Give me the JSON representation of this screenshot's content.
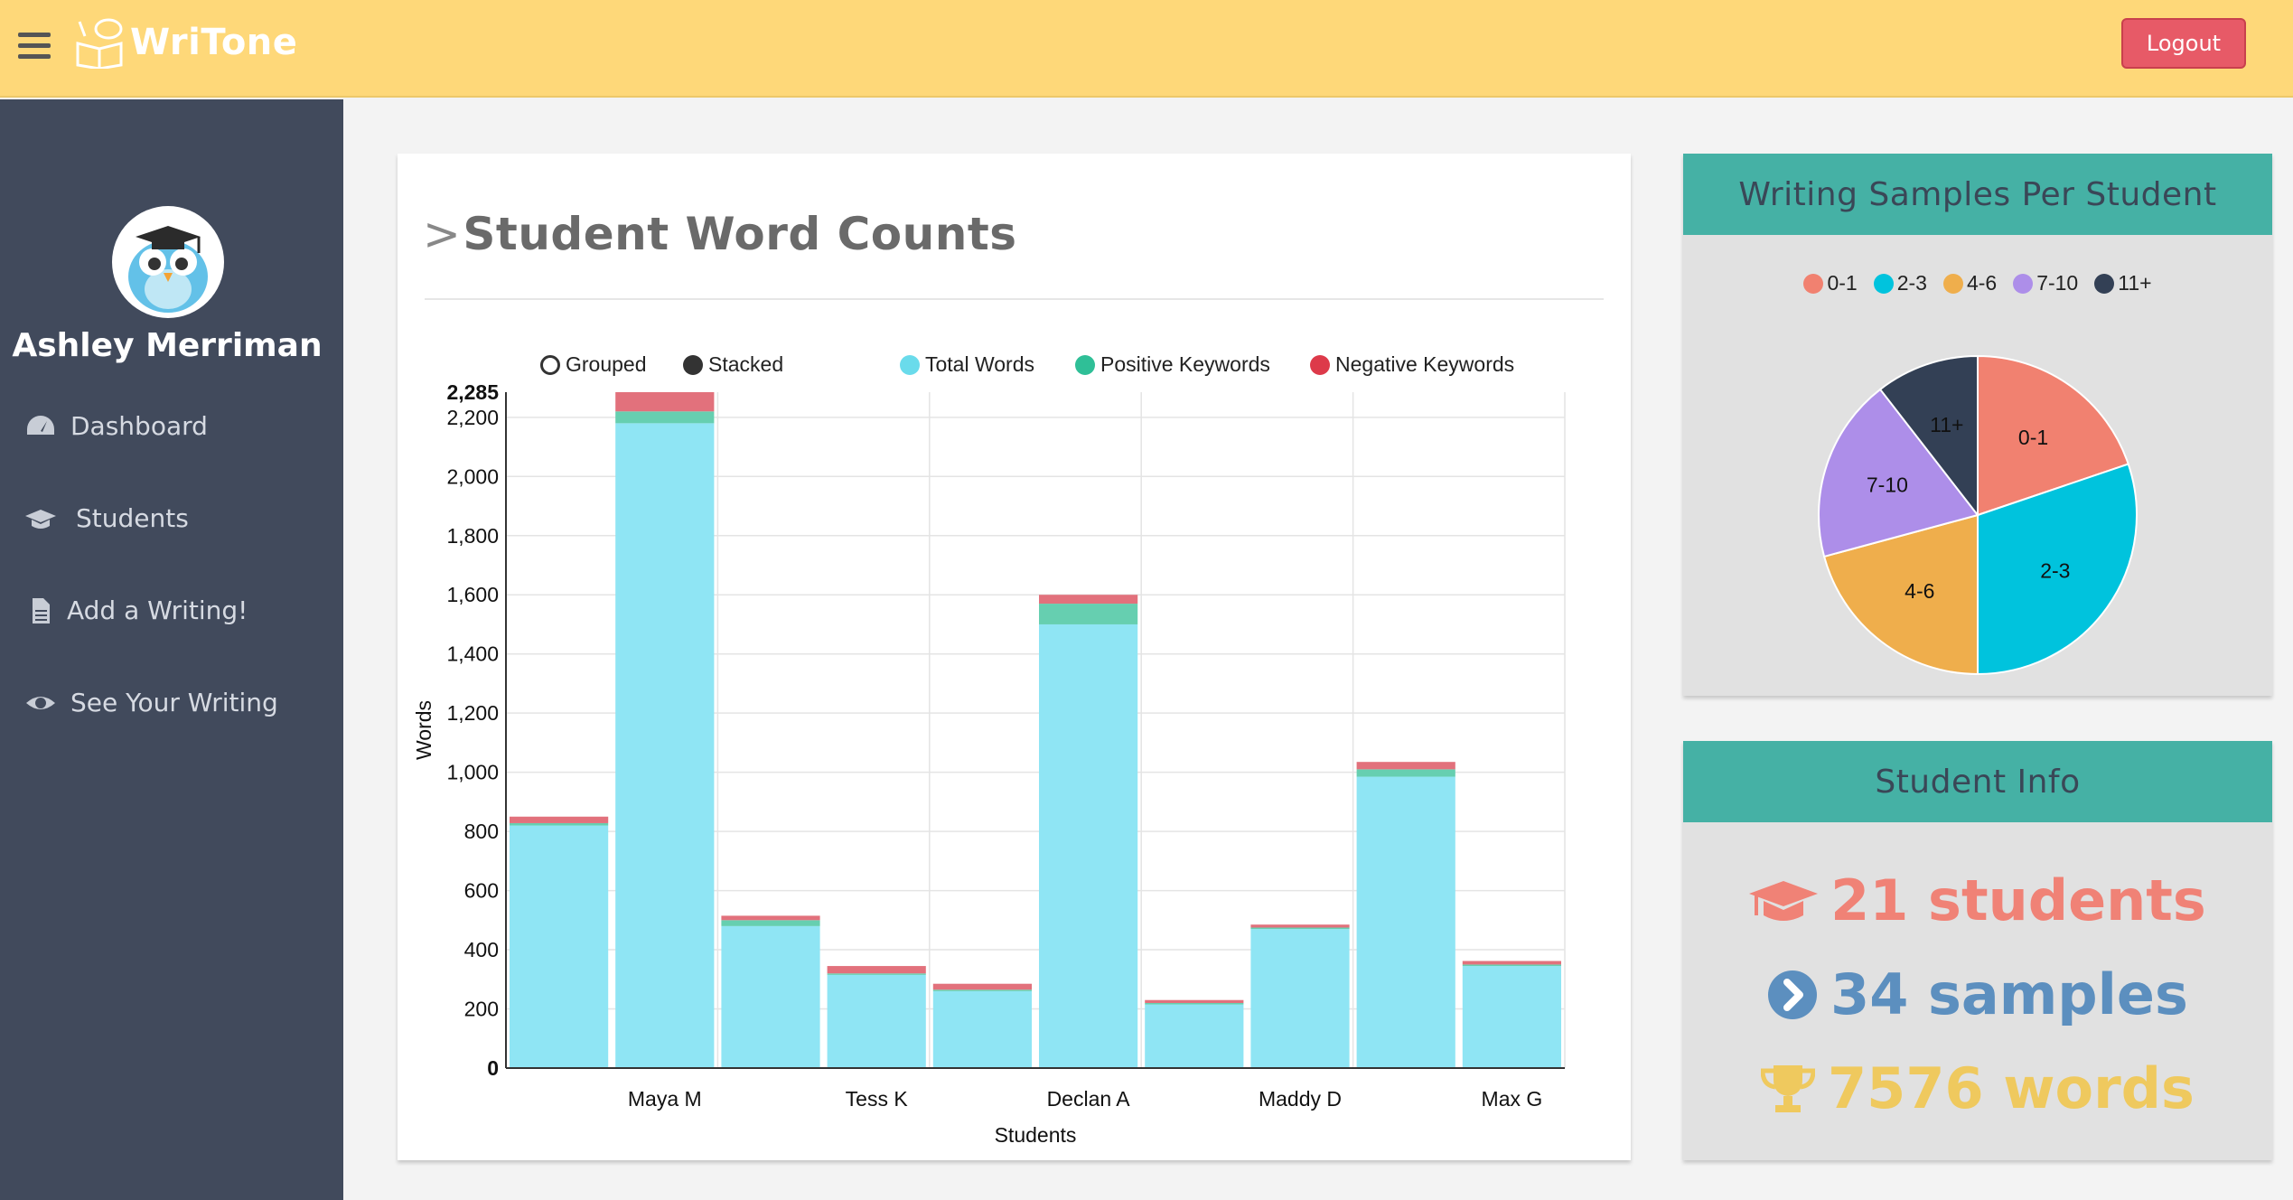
{
  "header": {
    "app_name": "WriTone",
    "logout_label": "Logout"
  },
  "sidebar": {
    "user_name": "Ashley Merriman",
    "items": [
      {
        "label": "Dashboard",
        "icon": "dashboard-icon"
      },
      {
        "label": "Students",
        "icon": "graduation-cap-icon"
      },
      {
        "label": "Add a Writing!",
        "icon": "file-icon"
      },
      {
        "label": "See Your Writing",
        "icon": "eye-icon"
      }
    ]
  },
  "main": {
    "title": "Student Word Counts",
    "title_prefix": ">",
    "mode_grouped": "Grouped",
    "mode_stacked": "Stacked",
    "legend": [
      "Total Words",
      "Positive Keywords",
      "Negative Keywords"
    ]
  },
  "chart_data": {
    "type": "bar",
    "stacked": true,
    "xlabel": "Students",
    "ylabel": "Words",
    "ylim": [
      0,
      2285
    ],
    "ymax_label": "2,285",
    "yticks": [
      0,
      200,
      400,
      600,
      800,
      1000,
      1200,
      1400,
      1600,
      1800,
      2000,
      2200
    ],
    "categories": [
      "",
      "Maya M",
      "",
      "Tess K",
      "",
      "Declan A",
      "",
      "Maddy D",
      "",
      "Max G"
    ],
    "series": [
      {
        "name": "Total Words",
        "color": "#8fe5f4",
        "values": [
          820,
          2180,
          480,
          315,
          260,
          1500,
          215,
          470,
          985,
          345
        ]
      },
      {
        "name": "Positive Keywords",
        "color": "#66cfb0",
        "values": [
          8,
          40,
          20,
          5,
          5,
          70,
          5,
          5,
          25,
          5
        ]
      },
      {
        "name": "Negative Keywords",
        "color": "#e2717c",
        "values": [
          22,
          65,
          15,
          25,
          20,
          30,
          10,
          10,
          25,
          12
        ]
      }
    ],
    "grid": true
  },
  "pie": {
    "title": "Writing Samples Per Student",
    "chart_data": {
      "type": "pie",
      "labels": [
        "0-1",
        "2-3",
        "4-6",
        "7-10",
        "11+"
      ],
      "values": [
        19.8,
        30.2,
        20.8,
        18.7,
        10.5
      ],
      "colors": [
        "#f18170",
        "#00c3dd",
        "#efae4c",
        "#ad8ee9",
        "#334055"
      ]
    }
  },
  "info": {
    "title": "Student Info",
    "students": "21 students",
    "samples": "34 samples",
    "words": "7576 words",
    "colors": {
      "students": "#f08276",
      "samples": "#5c8fbf",
      "words": "#efc95e"
    }
  }
}
